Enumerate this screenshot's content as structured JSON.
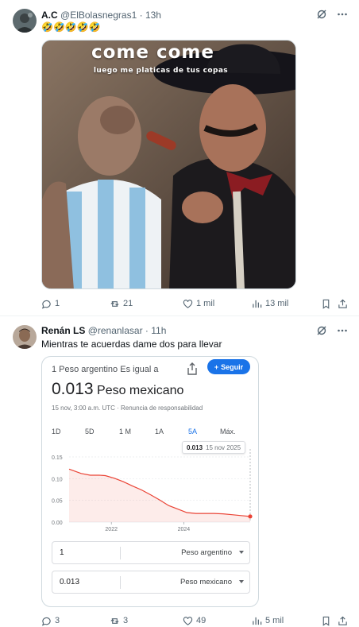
{
  "tweets": [
    {
      "author_name": "A.C",
      "handle": "@ElBolasnegras1",
      "time": "13h",
      "text": "🤣🤣🤣🤣🤣",
      "image": {
        "overlay_title": "come come",
        "overlay_subtitle": "luego me platicas de tus copas"
      },
      "stats": {
        "replies": "1",
        "reposts": "21",
        "likes": "1 mil",
        "views": "13 mil"
      }
    },
    {
      "author_name": "Renán LS",
      "handle": "@renanlasar",
      "time": "11h",
      "text": "Mientras te acuerdas dame dos para llevar",
      "card": {
        "title": "1 Peso argentino Es igual a",
        "follow_label": "Seguir",
        "rate_value": "0.013",
        "rate_currency": "Peso mexicano",
        "date_line": "15 nov, 3:00 a.m. UTC · Renuncia de responsabilidad",
        "ranges": [
          "1D",
          "5D",
          "1 M",
          "1A",
          "5A",
          "Máx."
        ],
        "active_range": "5A",
        "tooltip_value": "0.013",
        "tooltip_date": "15 nov 2025",
        "from_amount": "1",
        "from_currency": "Peso argentino",
        "to_amount": "0.013",
        "to_currency": "Peso mexicano"
      },
      "stats": {
        "replies": "3",
        "reposts": "3",
        "likes": "49",
        "views": "5 mil"
      }
    }
  ],
  "chart_data": {
    "type": "line",
    "x_tick_labels": [
      "2022",
      "2024"
    ],
    "y_tick_labels": [
      "0.15",
      "0.10",
      "0.05",
      "0.00"
    ],
    "ylim": [
      0,
      0.15
    ],
    "x": [
      "2020-11",
      "2021-03",
      "2021-06",
      "2021-09",
      "2021-11",
      "2022-02",
      "2022-05",
      "2022-08",
      "2022-11",
      "2023-02",
      "2023-05",
      "2023-08",
      "2023-11",
      "2024-02",
      "2024-05",
      "2024-08",
      "2024-11",
      "2025-02",
      "2025-05",
      "2025-08",
      "2025-11"
    ],
    "values": [
      0.122,
      0.112,
      0.108,
      0.108,
      0.107,
      0.101,
      0.093,
      0.083,
      0.074,
      0.063,
      0.051,
      0.038,
      0.03,
      0.022,
      0.02,
      0.02,
      0.02,
      0.019,
      0.017,
      0.015,
      0.013
    ],
    "color": "#ea4335"
  }
}
